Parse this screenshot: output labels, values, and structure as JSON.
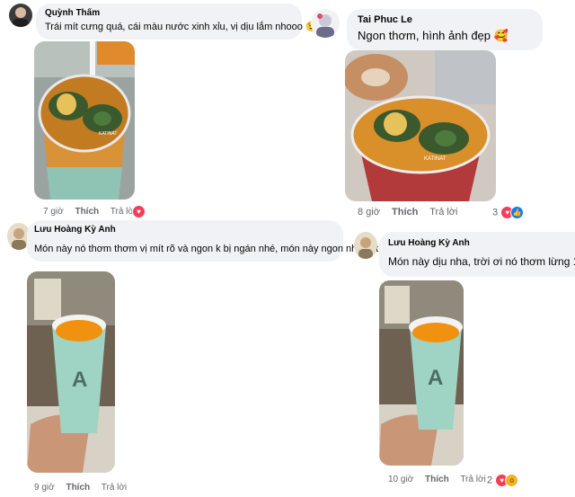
{
  "comments": [
    {
      "author": "Quỳnh Thấm",
      "text": "Trái mít cưng quá, cái màu nước xinh xỉu, vị dịu lắm nhooo",
      "emoji": "😉",
      "time": "7 giờ",
      "like_label": "Thích",
      "reply_label": "Trả lời",
      "reactions": {
        "count": "",
        "icons": [
          "heart-icon"
        ]
      }
    },
    {
      "author": "Tai Phuc Le",
      "text": "Ngon thơm, hình ảnh đẹp",
      "emoji": "🥰",
      "time": "8 giờ",
      "like_label": "Thích",
      "reply_label": "Trả lời",
      "reactions": {
        "count": "3",
        "icons": [
          "heart-icon",
          "like-icon"
        ]
      }
    },
    {
      "author": "Lưu Hoàng Kỳ Anh",
      "text": "Món này nó thơm thơm vị mít rõ và ngon k bị ngán nhé, món này ngon nhé kat",
      "emoji": "🥰",
      "time": "9 giờ",
      "like_label": "Thích",
      "reply_label": "Trả lời",
      "reactions": {
        "count": "",
        "icons": []
      }
    },
    {
      "author": "Lưu Hoàng Kỳ Anh",
      "text": "Món này dịu nha, trời ơi nó thơm lừng 10đ",
      "emoji": "",
      "time": "10 giờ",
      "like_label": "Thích",
      "reply_label": "Trả lời",
      "reactions": {
        "count": "2",
        "icons": [
          "heart-icon",
          "wow-icon"
        ]
      }
    }
  ],
  "cup_label": "A",
  "sticker_label": "KATINAT",
  "colors": {
    "bubble": "#f0f2f5",
    "meta": "#65676b",
    "heart": "#f33e58",
    "like": "#1877f2",
    "wow": "#f7b125"
  }
}
